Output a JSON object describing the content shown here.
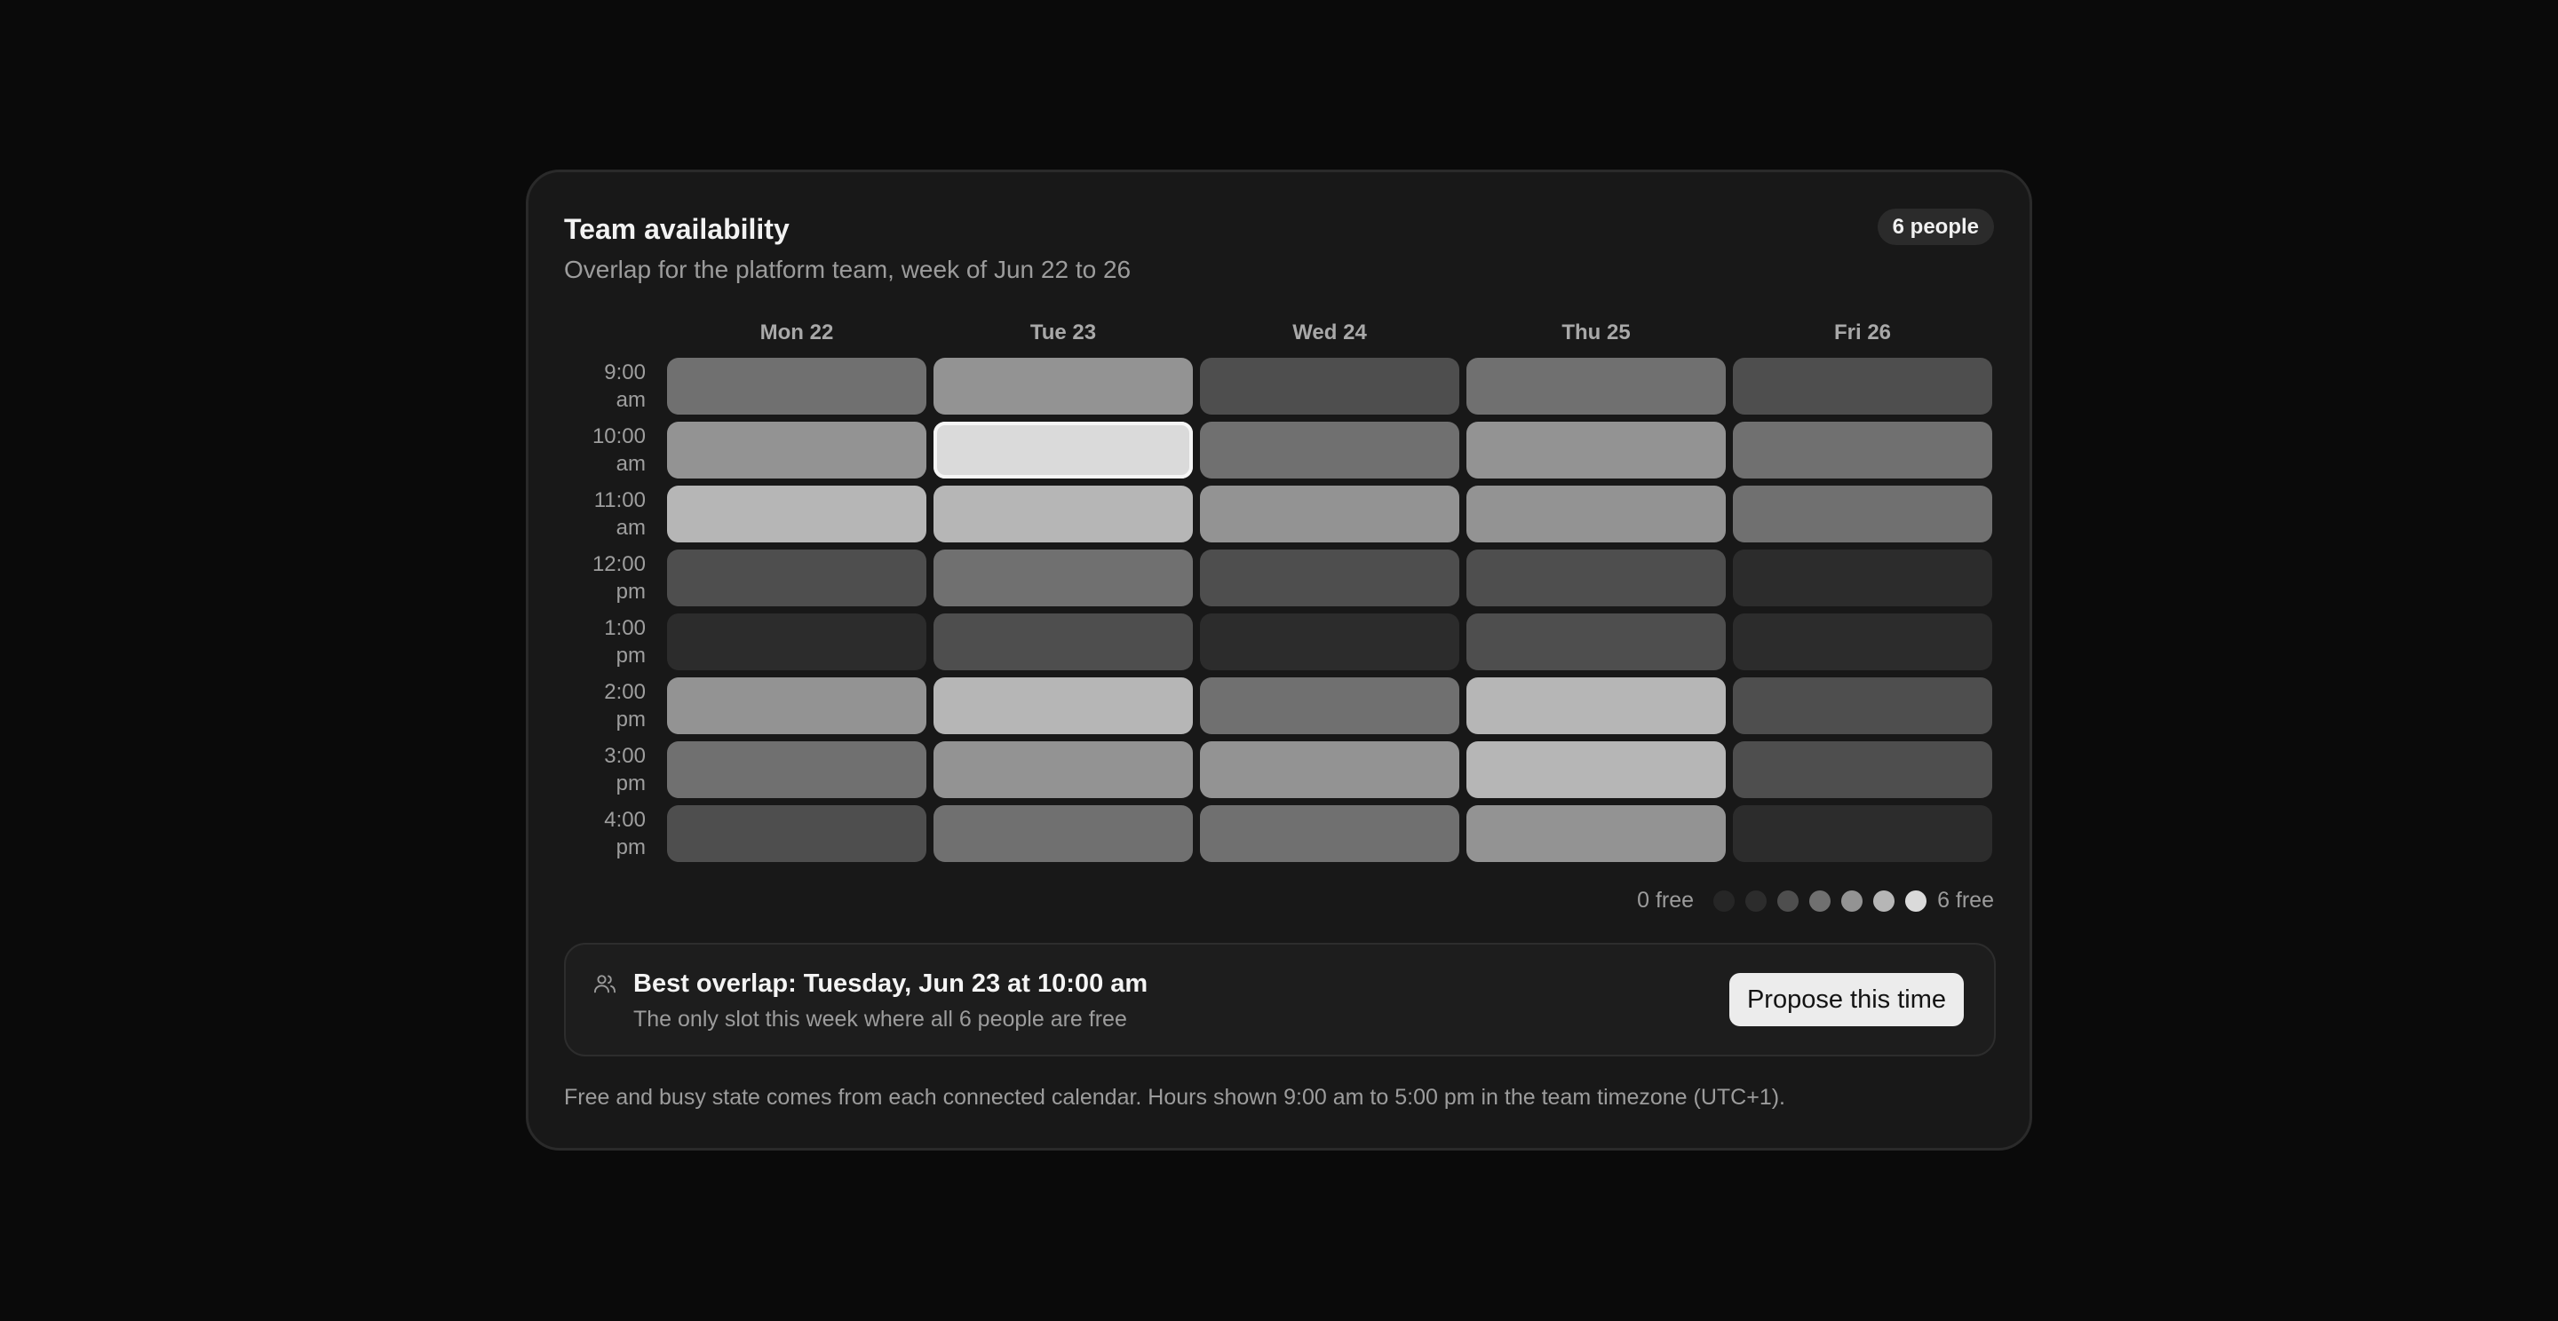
{
  "card": {
    "title": "Team availability",
    "subtitle": "Overlap for the platform team, week of Jun 22 to 26",
    "people_badge": "6 people"
  },
  "days": [
    "Mon 22",
    "Tue 23",
    "Wed 24",
    "Thu 25",
    "Fri 26"
  ],
  "times": [
    "9:00 am",
    "10:00 am",
    "11:00 am",
    "12:00 pm",
    "1:00 pm",
    "2:00 pm",
    "3:00 pm",
    "4:00 pm"
  ],
  "free_counts": [
    [
      3,
      4,
      2,
      3,
      2
    ],
    [
      4,
      6,
      3,
      4,
      3
    ],
    [
      5,
      5,
      4,
      4,
      3
    ],
    [
      2,
      3,
      2,
      2,
      1
    ],
    [
      1,
      2,
      1,
      2,
      1
    ],
    [
      4,
      5,
      3,
      5,
      2
    ],
    [
      3,
      4,
      4,
      5,
      2
    ],
    [
      2,
      3,
      3,
      4,
      1
    ]
  ],
  "best_slot": {
    "row": 1,
    "col": 1
  },
  "legend": {
    "min_label": "0 free",
    "max_label": "6 free",
    "levels": [
      0,
      1,
      2,
      3,
      4,
      5,
      6
    ]
  },
  "colors": {
    "levels": [
      "#262626",
      "#2c2c2c",
      "#4e4e4e",
      "#707070",
      "#939393",
      "#b6b6b6",
      "#dadada"
    ],
    "best_outline": "#f5f5f5"
  },
  "best_overlap": {
    "icon": "users-icon",
    "title": "Best overlap: Tuesday, Jun 23 at 10:00 am",
    "subtitle": "The only slot this week where all 6 people are free",
    "button_label": "Propose this time"
  },
  "footnote": "Free and busy state comes from each connected calendar. Hours shown 9:00 am to 5:00 pm in the team timezone (UTC+1)."
}
